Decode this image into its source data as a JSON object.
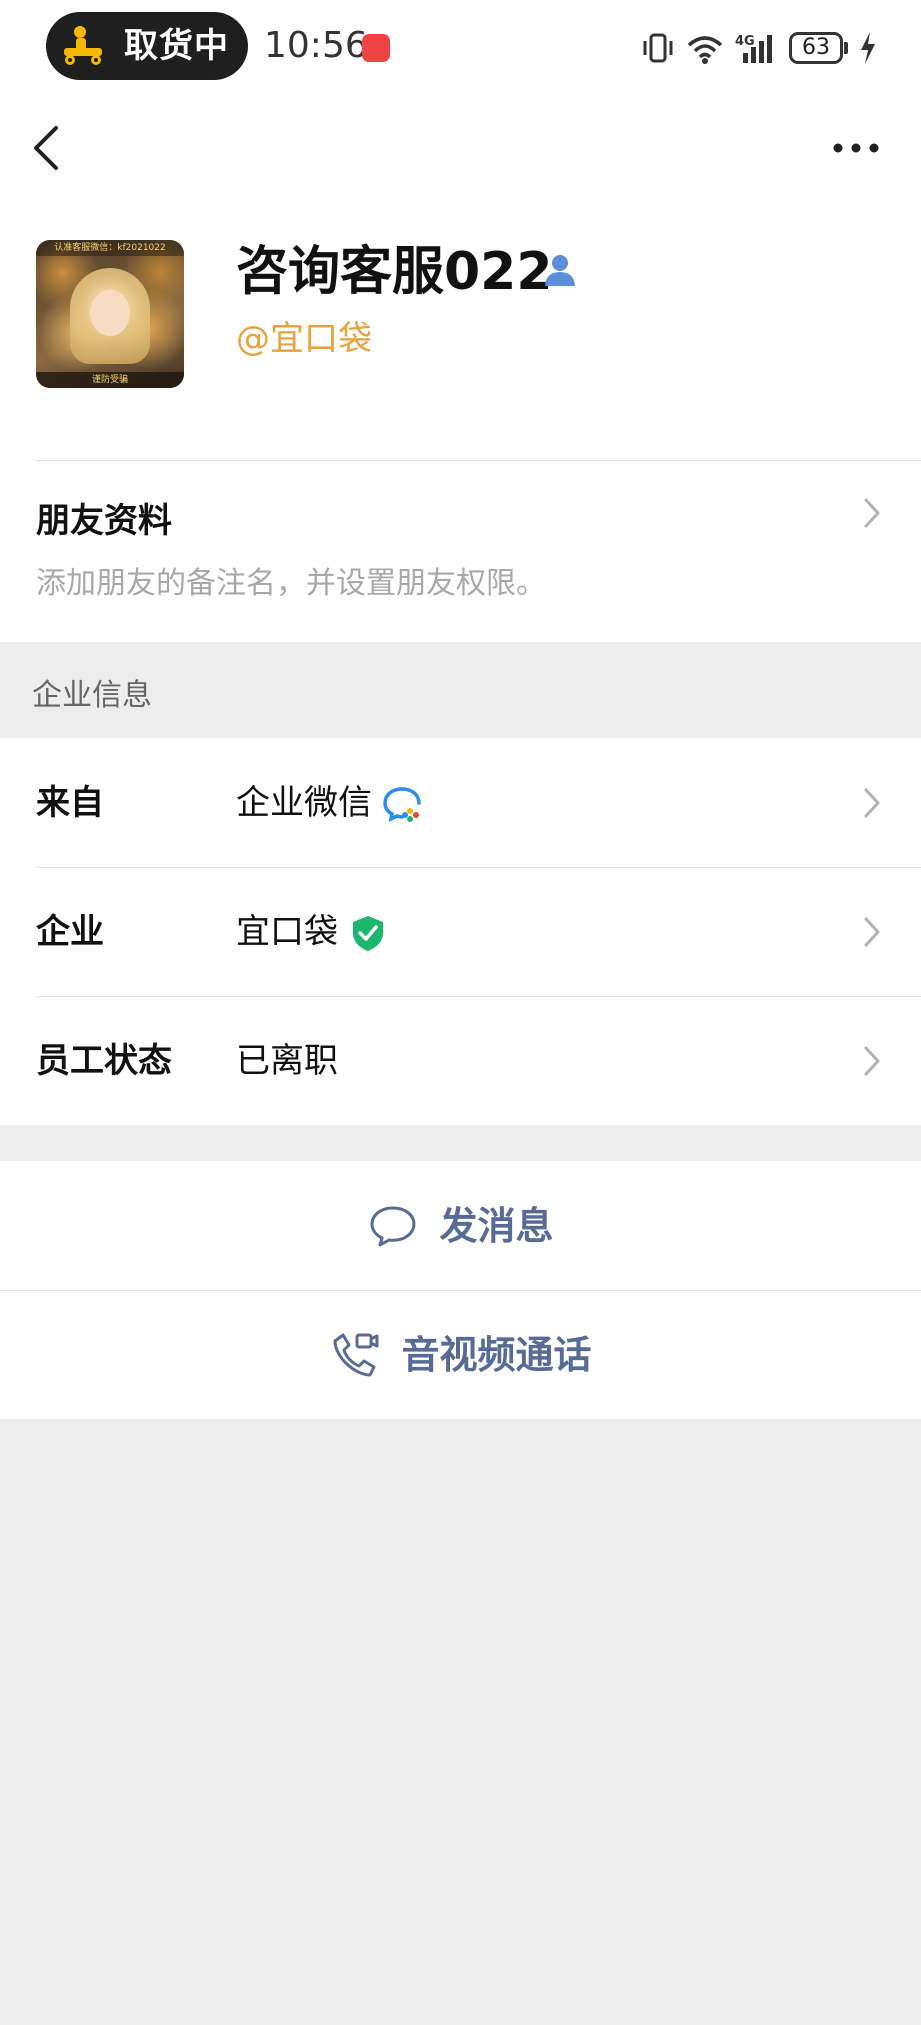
{
  "status_bar": {
    "pill_text": "取货中",
    "time": "10:56",
    "battery": "63",
    "network": "4G"
  },
  "profile": {
    "name": "咨询客服022",
    "org_handle": "@宜口袋",
    "avatar_top_text": "认准客服微信：kf2021022",
    "avatar_bottom_text": "谨防受骗"
  },
  "friend_info": {
    "title": "朋友资料",
    "description": "添加朋友的备注名，并设置朋友权限。"
  },
  "enterprise": {
    "section_title": "企业信息",
    "rows": [
      {
        "label": "来自",
        "value": "企业微信"
      },
      {
        "label": "企业",
        "value": "宜口袋"
      },
      {
        "label": "员工状态",
        "value": "已离职"
      }
    ]
  },
  "actions": {
    "message_label": "发消息",
    "call_label": "音视频通话"
  },
  "colors": {
    "accent_link": "#576b95",
    "org_orange": "#e9a23b",
    "verified_green": "#1bb76e",
    "background_gray": "#ededed"
  },
  "icons": {
    "back": "chevron-left-icon",
    "more": "more-dots-icon",
    "verified": "person-badge-icon",
    "wecom": "wecom-logo-icon",
    "shield": "verified-shield-icon",
    "message": "chat-bubble-icon",
    "call": "phone-video-icon"
  }
}
